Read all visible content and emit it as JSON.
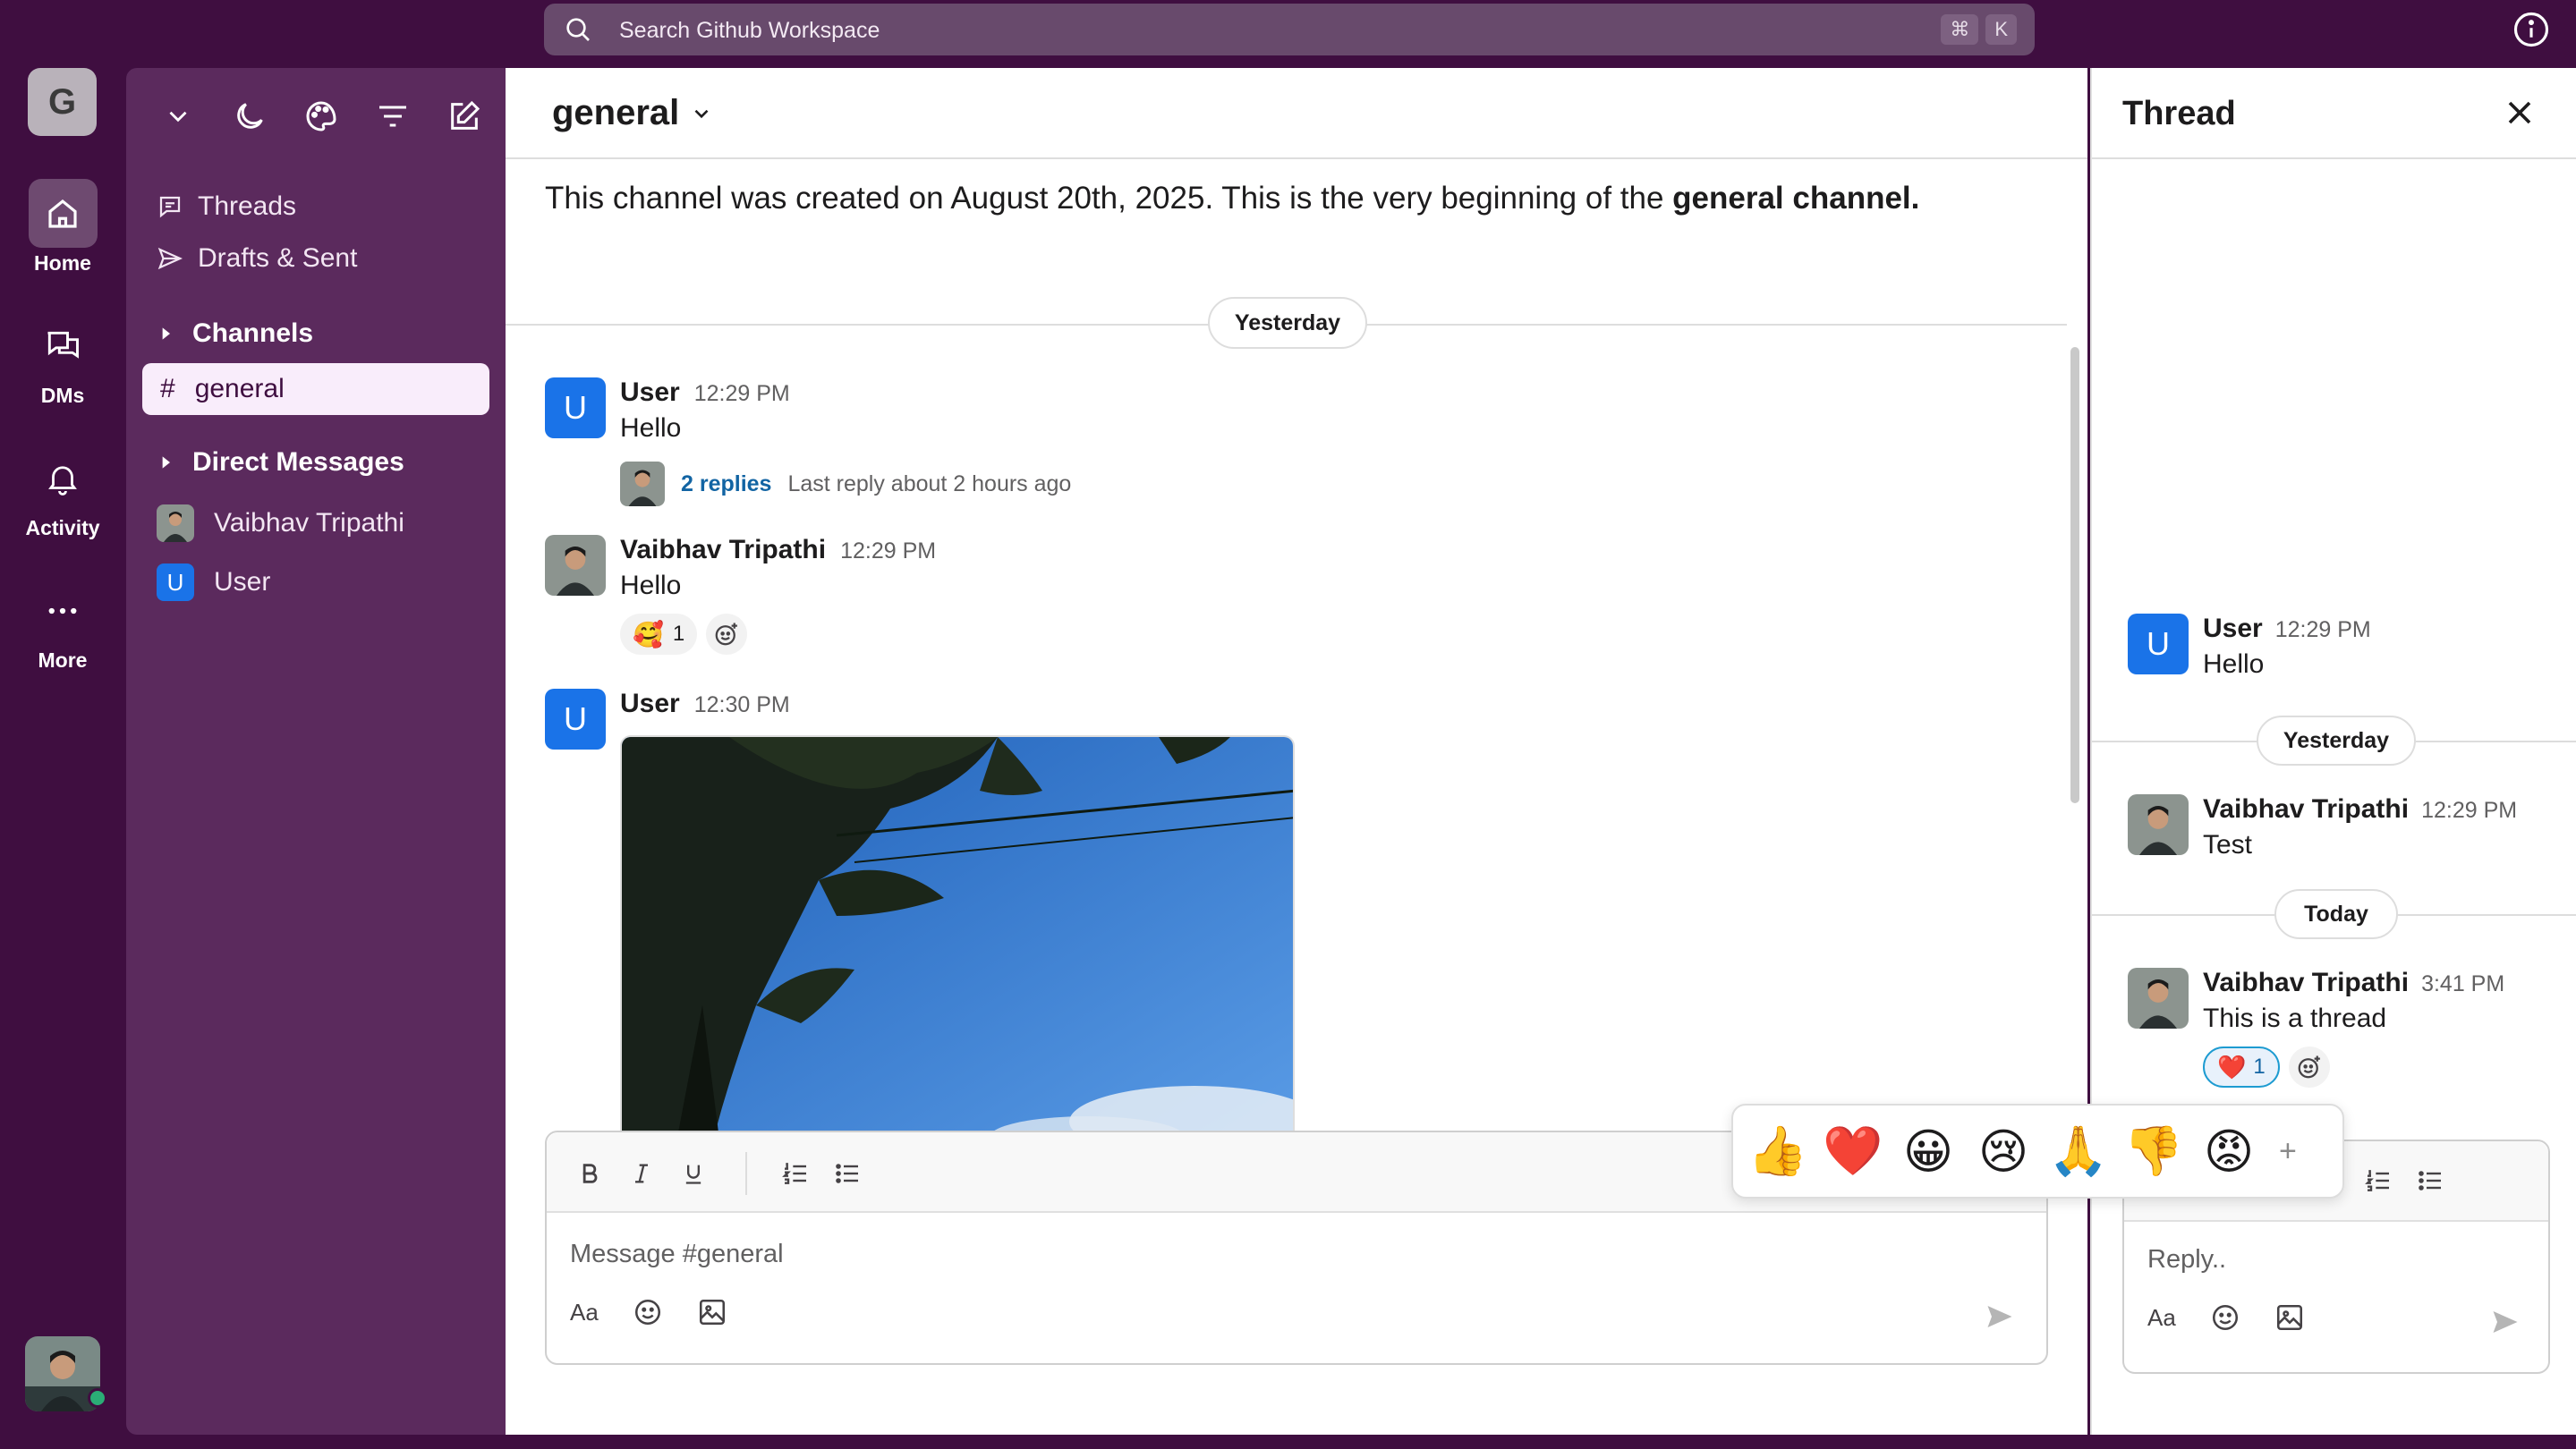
{
  "search": {
    "placeholder": "Search Github Workspace",
    "shortcut_cmd": "⌘",
    "shortcut_key": "K"
  },
  "workspace": {
    "initial": "G"
  },
  "rail": [
    {
      "label": "Home",
      "icon": "home-icon"
    },
    {
      "label": "DMs",
      "icon": "dms-icon"
    },
    {
      "label": "Activity",
      "icon": "bell-icon"
    },
    {
      "label": "More",
      "icon": "more-icon"
    }
  ],
  "sidebar": {
    "threads_label": "Threads",
    "drafts_label": "Drafts & Sent",
    "channels_label": "Channels",
    "channel_hash": "#",
    "channel_general": "general",
    "dm_label": "Direct Messages",
    "dm_items": [
      {
        "name": "Vaibhav Tripathi"
      },
      {
        "name": "User",
        "initial": "U"
      }
    ]
  },
  "main": {
    "channel_name": "general",
    "intro_prefix": "This channel was created on August 20th, 2025. This is the very beginning of the ",
    "intro_bold": "general channel.",
    "date_pill": "Yesterday",
    "messages": [
      {
        "name": "User",
        "initial": "U",
        "time": "12:29 PM",
        "text": "Hello",
        "replies": "2 replies",
        "last_reply": "Last reply about 2 hours ago"
      },
      {
        "name": "Vaibhav Tripathi",
        "time": "12:29 PM",
        "text": "Hello",
        "reaction_emoji": "🥰",
        "reaction_count": "1"
      },
      {
        "name": "User",
        "initial": "U",
        "time": "12:30 PM"
      }
    ],
    "composer_placeholder": "Message #general",
    "format_aa": "Aa"
  },
  "emoji_picker": [
    "👍",
    "❤️",
    "😀",
    "😢",
    "🙏",
    "👎",
    "😡"
  ],
  "emoji_plus": "+",
  "thread": {
    "title": "Thread",
    "parent": {
      "name": "User",
      "initial": "U",
      "time": "12:29 PM",
      "text": "Hello"
    },
    "pill_yesterday": "Yesterday",
    "reply1": {
      "name": "Vaibhav Tripathi",
      "time": "12:29 PM",
      "text": "Test"
    },
    "pill_today": "Today",
    "reply2": {
      "name": "Vaibhav Tripathi",
      "time": "3:41 PM",
      "text": "This is a thread",
      "reaction_emoji": "❤️",
      "reaction_count": "1"
    },
    "composer_placeholder": "Reply..",
    "format_aa": "Aa"
  },
  "colors": {
    "aubergine": "#3f0e40",
    "sidebar": "#5b2a5d",
    "link": "#1264a3",
    "user_avatar": "#1a73e8"
  }
}
